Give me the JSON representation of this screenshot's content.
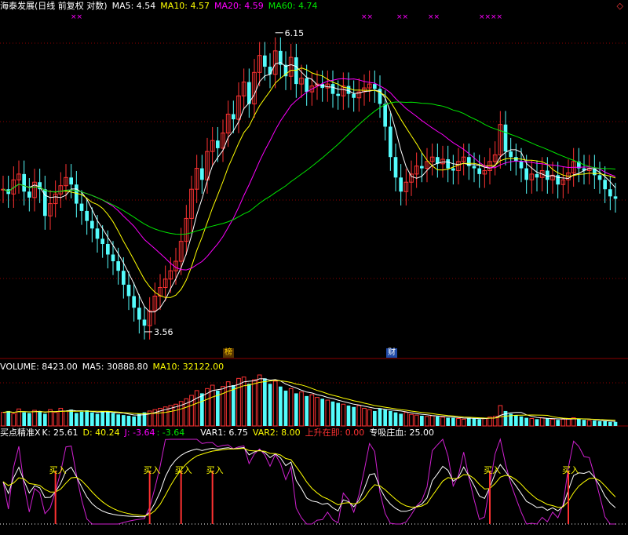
{
  "colors": {
    "up": "#ff3232",
    "down": "#54fcfc",
    "ma5": "#ffffff",
    "ma10": "#ffff00",
    "ma20": "#ff00ff",
    "ma60": "#00e600",
    "grid": "#8b0000",
    "k": "#ffffff",
    "d": "#ffff00",
    "j": "#d020d0",
    "signal": "#ff3232",
    "label": "#ffff00"
  },
  "price_header": {
    "title": "海泰发展(日线 前复权 对数)",
    "ma5": "MA5: 4.54",
    "ma10": "MA10: 4.57",
    "ma20": "MA20: 4.59",
    "ma60": "MA60: 4.74"
  },
  "price_marks": {
    "high": "6.15",
    "low": "3.56",
    "tag1": "榜",
    "tag2": "财",
    "cross": "××"
  },
  "vol_header": {
    "label": "VOLUME: 8423.00",
    "ma5": "MA5: 30888.80",
    "ma10": "MA10: 32122.00"
  },
  "ind_header": {
    "title": "买点精准X",
    "k": "K: 25.61",
    "d": "D: 40.24",
    "j": "J: -3.64",
    "extra": ": -3.64",
    "var1": "VAR1: 6.75",
    "var2": "VAR2: 8.00",
    "rise": "上升在即: 0.00",
    "suck": "专吸庄血: 25.00"
  },
  "buy_label": "买入",
  "chart_data": [
    {
      "type": "candlestick",
      "title": "海泰发展(日线 前复权 对数)",
      "scale": "log",
      "ylim": [
        3.4,
        6.4
      ],
      "annotations": {
        "high": 6.15,
        "low": 3.56
      },
      "close": [
        4.62,
        4.58,
        4.7,
        4.75,
        4.6,
        4.55,
        4.68,
        4.62,
        4.4,
        4.5,
        4.58,
        4.65,
        4.72,
        4.66,
        4.5,
        4.44,
        4.36,
        4.3,
        4.22,
        4.18,
        4.1,
        4.05,
        3.98,
        3.88,
        3.8,
        3.72,
        3.64,
        3.6,
        3.7,
        3.8,
        3.86,
        3.92,
        3.98,
        4.05,
        4.2,
        4.38,
        4.62,
        4.8,
        4.7,
        4.95,
        5.05,
        4.98,
        5.12,
        5.3,
        5.25,
        5.48,
        5.62,
        5.4,
        5.72,
        5.9,
        5.78,
        5.7,
        5.95,
        5.8,
        5.68,
        5.88,
        5.6,
        5.66,
        5.52,
        5.58,
        5.6,
        5.56,
        5.6,
        5.5,
        5.48,
        5.58,
        5.5,
        5.46,
        5.52,
        5.56,
        5.6,
        5.55,
        5.4,
        5.18,
        4.9,
        4.72,
        4.6,
        4.68,
        4.75,
        4.82,
        4.8,
        4.86,
        4.9,
        4.84,
        4.88,
        4.8,
        4.78,
        4.86,
        4.9,
        4.82,
        4.8,
        4.75,
        4.78,
        4.86,
        4.92,
        5.2,
        4.95,
        4.9,
        4.86,
        4.8,
        4.7,
        4.75,
        4.72,
        4.78,
        4.7,
        4.74,
        4.66,
        4.7,
        4.76,
        4.86,
        4.8,
        4.78,
        4.8,
        4.74,
        4.7,
        4.62,
        4.56,
        4.54
      ],
      "ma_values": {
        "MA5": 4.54,
        "MA10": 4.57,
        "MA20": 4.59,
        "MA60": 4.74
      }
    },
    {
      "type": "bar",
      "title": "VOLUME",
      "values": [
        20,
        22,
        18,
        25,
        20,
        19,
        23,
        21,
        18,
        24,
        20,
        26,
        22,
        24,
        19,
        21,
        23,
        20,
        18,
        22,
        21,
        19,
        17,
        16,
        15,
        14,
        18,
        20,
        22,
        24,
        26,
        28,
        30,
        32,
        36,
        40,
        45,
        52,
        48,
        55,
        60,
        52,
        58,
        65,
        60,
        70,
        72,
        62,
        68,
        75,
        70,
        62,
        66,
        58,
        52,
        55,
        48,
        50,
        44,
        46,
        42,
        40,
        38,
        36,
        34,
        32,
        30,
        28,
        30,
        26,
        24,
        22,
        26,
        24,
        22,
        20,
        18,
        20,
        17,
        16,
        15,
        14,
        15,
        14,
        13,
        12,
        12,
        11,
        10,
        12,
        11,
        10,
        11,
        13,
        14,
        30,
        22,
        18,
        16,
        14,
        12,
        11,
        10,
        12,
        11,
        10,
        9,
        10,
        11,
        12,
        10,
        9,
        8,
        8,
        7,
        7,
        6,
        6
      ],
      "ma_values": {
        "MA5": 30888.8,
        "MA10": 32122.0
      },
      "last": 8423.0
    },
    {
      "type": "line",
      "title": "买点精准X",
      "series": [
        {
          "name": "K",
          "last": 25.61
        },
        {
          "name": "D",
          "last": 40.24
        },
        {
          "name": "J",
          "last": -3.64
        }
      ],
      "var1": 6.75,
      "var2": 8.0,
      "rise": 0.0,
      "suck": 25.0
    }
  ]
}
